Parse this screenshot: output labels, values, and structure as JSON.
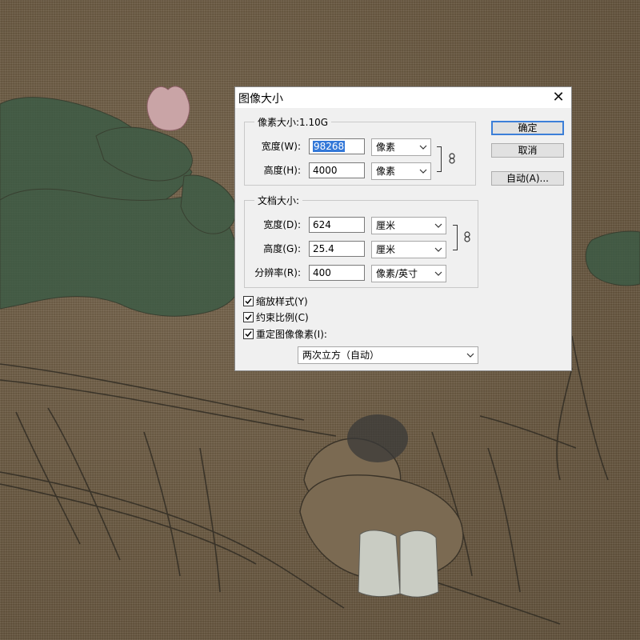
{
  "dialog": {
    "title": "图像大小",
    "close_glyph": "✕",
    "pixel_group": {
      "legend": "像素大小:1.10G",
      "width_label": "宽度(W):",
      "width_value": "98268",
      "width_unit": "像素",
      "height_label": "高度(H):",
      "height_value": "4000",
      "height_unit": "像素"
    },
    "document_group": {
      "legend": "文档大小:",
      "width_label": "宽度(D):",
      "width_value": "624",
      "width_unit": "厘米",
      "height_label": "高度(G):",
      "height_value": "25.4",
      "height_unit": "厘米",
      "resolution_label": "分辨率(R):",
      "resolution_value": "400",
      "resolution_unit": "像素/英寸"
    },
    "options": [
      {
        "label": "缩放样式(Y)",
        "checked": true
      },
      {
        "label": "约束比例(C)",
        "checked": true
      },
      {
        "label": "重定图像像素(I):",
        "checked": true
      }
    ],
    "resample_method": "两次立方（自动）",
    "buttons": {
      "ok": "确定",
      "cancel": "取消",
      "auto": "自动(A)..."
    }
  },
  "icons": {
    "close": "close-icon",
    "chain": "chain-link-icon",
    "dropdown": "chevron-down-icon",
    "check": "checkmark-icon"
  },
  "colors": {
    "selection": "#3378d8",
    "default_button_border": "#3c7fd8",
    "dialog_bg": "#f0f0f0",
    "canvas_bg": "#6b5a41"
  }
}
